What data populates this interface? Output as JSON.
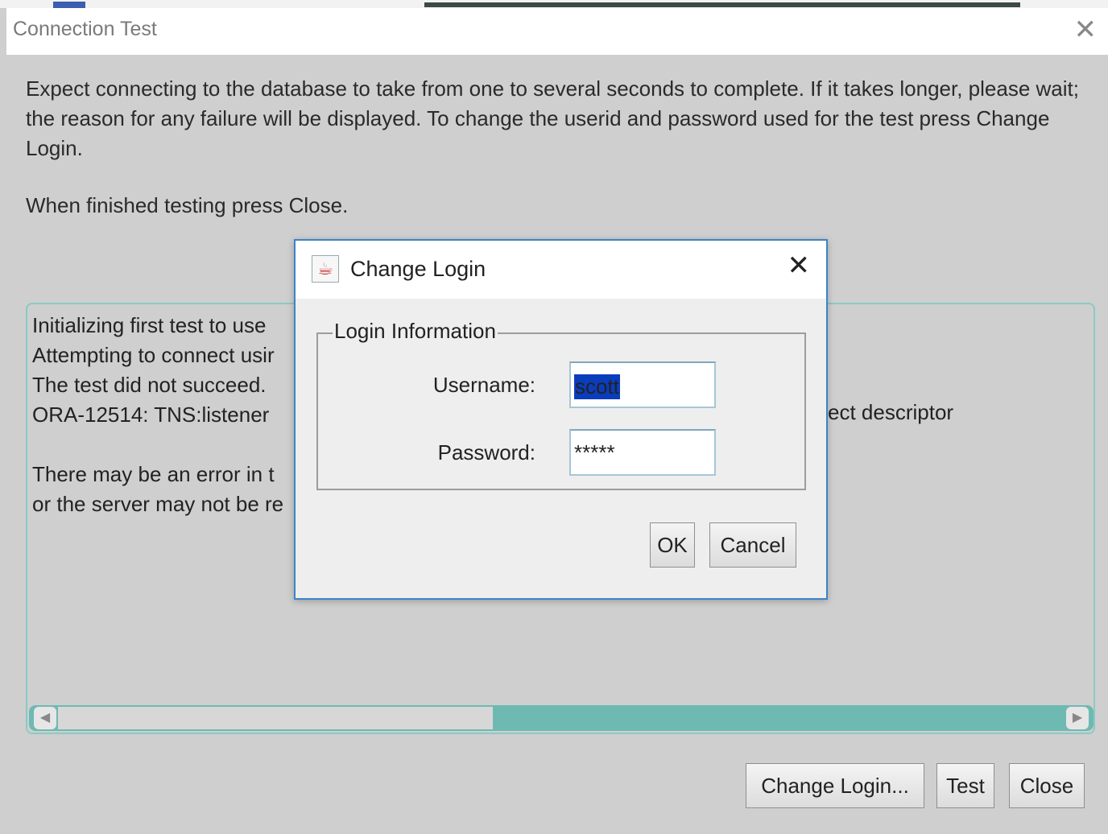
{
  "outer_window": {
    "title": "Connection Test",
    "close_glyph": "✕",
    "instructions": "Expect connecting to the database to take from one to several seconds to complete. If it takes longer, please wait; the reason for any failure will be displayed. To change the userid and password used for the test press Change Login.",
    "instructions_close": "When finished testing press Close.",
    "log_lines": [
      "Initializing first test to use",
      "Attempting to connect usir",
      "The test did not succeed.",
      "ORA-12514: TNS:listener",
      "",
      "There may be an error in t",
      "or the server may not be re"
    ],
    "log_tail_line4": "ect descriptor",
    "buttons": {
      "change_login": "Change Login...",
      "test": "Test",
      "close": "Close"
    }
  },
  "dialog": {
    "title": "Change Login",
    "close_glyph": "✕",
    "group_label": "Login Information",
    "username_label": "Username:",
    "username_value": "scott",
    "password_label": "Password:",
    "password_value": "*****",
    "ok_label": "OK",
    "cancel_label": "Cancel"
  },
  "colors": {
    "selection": "#0a3dbd",
    "dialog_border": "#3b83c9",
    "scrollbar_track": "#6fb9b3"
  }
}
